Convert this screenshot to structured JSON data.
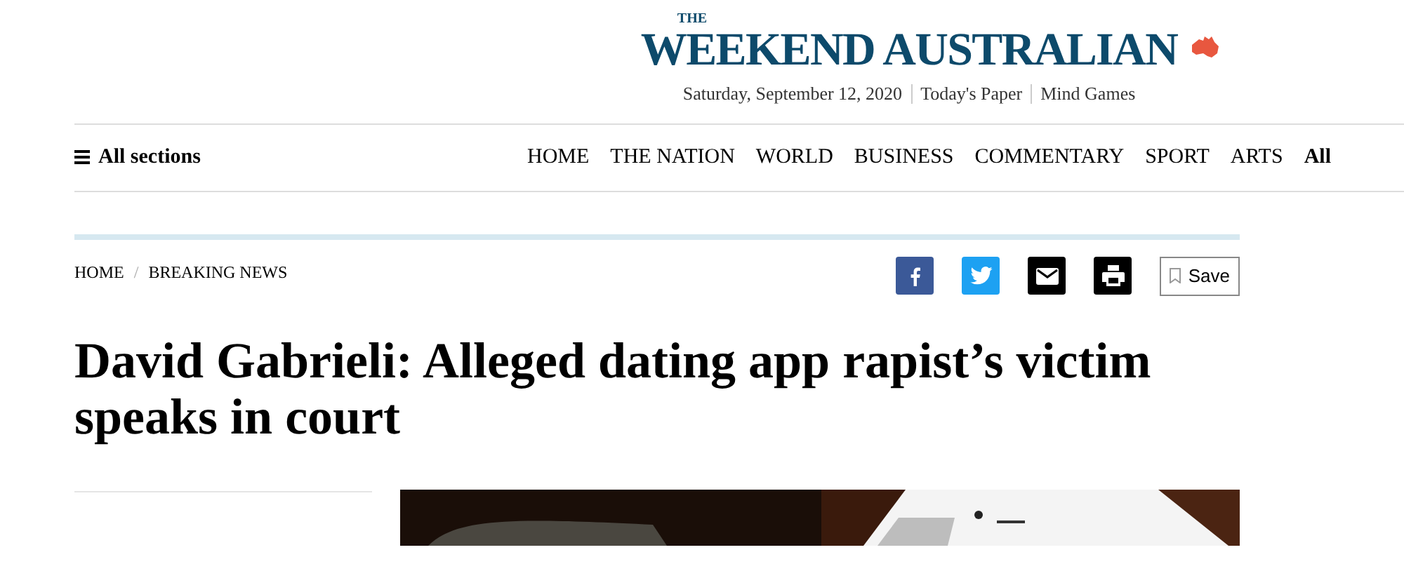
{
  "masthead": {
    "logo_small": "THE",
    "logo": "WEEKEND AUSTRALIAN",
    "date": "Saturday, September 12, 2020",
    "links": [
      "Today's Paper",
      "Mind Games"
    ]
  },
  "nav": {
    "menu": "All sections",
    "items": [
      {
        "label": "HOME",
        "selected": false
      },
      {
        "label": "THE NATION",
        "selected": false
      },
      {
        "label": "WORLD",
        "selected": false
      },
      {
        "label": "BUSINESS",
        "selected": false
      },
      {
        "label": "COMMENTARY",
        "selected": false
      },
      {
        "label": "SPORT",
        "selected": false
      },
      {
        "label": "ARTS",
        "selected": false
      },
      {
        "label": "All",
        "selected": true
      }
    ]
  },
  "breadcrumb": [
    "HOME",
    "BREAKING NEWS"
  ],
  "breadcrumb_separator": "/",
  "share": [
    {
      "kind": "facebook"
    },
    {
      "kind": "twitter"
    },
    {
      "kind": "email"
    },
    {
      "kind": "print"
    }
  ],
  "save": "Save",
  "headline": "David Gabrieli: Alleged dating app rapist’s victim speaks in court"
}
